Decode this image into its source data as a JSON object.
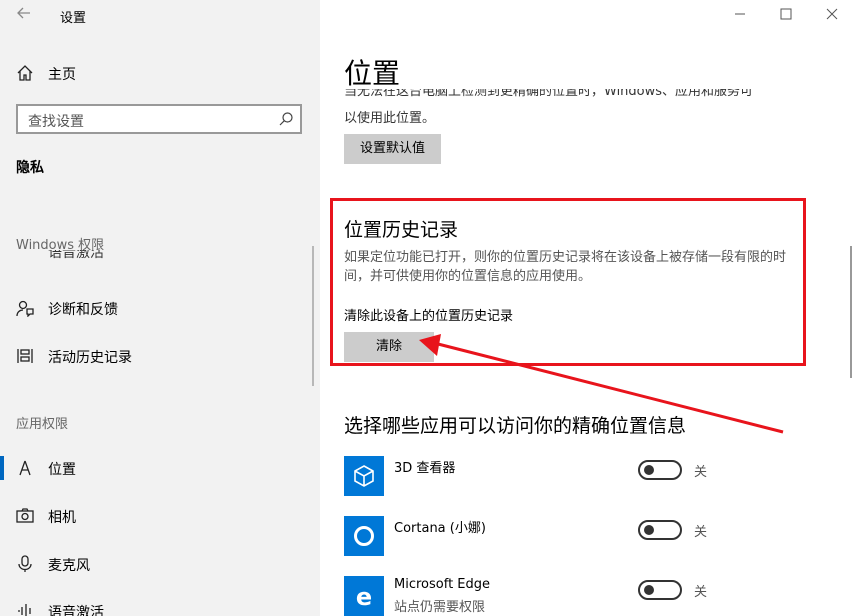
{
  "window": {
    "title": "设置",
    "back_icon": "back-arrow-icon",
    "controls": [
      "minimize-icon",
      "maximize-icon",
      "close-icon"
    ]
  },
  "sidebar": {
    "home": {
      "label": "主页",
      "icon": "home-icon"
    },
    "search": {
      "placeholder": "查找设置",
      "icon": "search-icon"
    },
    "category": "隐私",
    "windows_section": "Windows 权限",
    "cut_item_label": "语音激活",
    "items": [
      {
        "label": "诊断和反馈",
        "icon": "feedback-person-icon"
      },
      {
        "label": "活动历史记录",
        "icon": "timeline-icon"
      }
    ],
    "app_section": "应用权限",
    "app_items": [
      {
        "label": "位置",
        "icon": "location-icon",
        "active": true
      },
      {
        "label": "相机",
        "icon": "camera-icon"
      },
      {
        "label": "麦克风",
        "icon": "microphone-icon"
      },
      {
        "label": "语音激活",
        "icon": "voice-icon"
      }
    ]
  },
  "main": {
    "title": "位置",
    "intro_cut": "当无法在这台电脑上检测到更精确的位置时，Windows、应用和服务可",
    "intro_end": "以使用此位置。",
    "default_button": "设置默认值",
    "history": {
      "title": "位置历史记录",
      "description": "如果定位功能已打开，则你的位置历史记录将在该设备上被存储一段有限的时间，并可供使用你的位置信息的应用使用。",
      "clear_label": "清除此设备上的位置历史记录",
      "clear_button": "清除"
    },
    "apps_title": "选择哪些应用可以访问你的精确位置信息",
    "apps": [
      {
        "name": "3D 查看器",
        "sub": "",
        "icon": "cube-icon",
        "toggle": "关"
      },
      {
        "name": "Cortana (小娜)",
        "sub": "",
        "icon": "cortana-ring-icon",
        "toggle": "关"
      },
      {
        "name": "Microsoft Edge",
        "sub": "站点仍需要权限",
        "icon": "edge-icon",
        "toggle": "关"
      }
    ]
  },
  "annotation": {
    "highlight_color": "#e8141c"
  }
}
